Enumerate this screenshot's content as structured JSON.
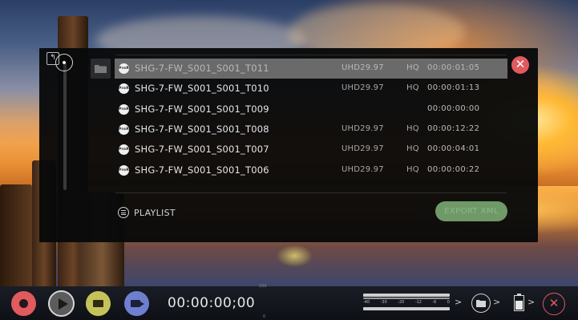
{
  "dialog": {
    "files": [
      {
        "name": "SHG-7-FW_S001_S001_T011",
        "codec": "ProRes",
        "format": "UHD29.97",
        "quality": "HQ",
        "duration": "00:00:01:05",
        "selected": true
      },
      {
        "name": "SHG-7-FW_S001_S001_T010",
        "codec": "ProRes",
        "format": "UHD29.97",
        "quality": "HQ",
        "duration": "00:00:01:13",
        "selected": false
      },
      {
        "name": "SHG-7-FW_S001_S001_T009",
        "codec": "ProRes",
        "format": "",
        "quality": "",
        "duration": "00:00:00:00",
        "selected": false
      },
      {
        "name": "SHG-7-FW_S001_S001_T008",
        "codec": "ProRes",
        "format": "UHD29.97",
        "quality": "HQ",
        "duration": "00:00:12:22",
        "selected": false
      },
      {
        "name": "SHG-7-FW_S001_S001_T007",
        "codec": "ProRes",
        "format": "UHD29.97",
        "quality": "HQ",
        "duration": "00:00:04:01",
        "selected": false
      },
      {
        "name": "SHG-7-FW_S001_S001_T006",
        "codec": "ProRes",
        "format": "UHD29.97",
        "quality": "HQ",
        "duration": "00:00:00:22",
        "selected": false
      }
    ],
    "playlist_label": "PLAYLIST",
    "export_label": "EXPORT XML",
    "close_glyph": "✕",
    "back_glyph": "↰"
  },
  "bottom_bar": {
    "timecode": "00:00:00;00",
    "meter_scale": [
      "-40",
      "-30",
      "-20",
      "-12",
      "-6",
      "0"
    ],
    "arrow_glyph": ">",
    "exit_glyph": "✕"
  },
  "icons": {
    "record": "record-icon",
    "play": "play-icon",
    "monitor": "monitor-icon",
    "camera": "camera-icon",
    "folder": "folder-icon",
    "battery": "battery-icon",
    "playlist": "playlist-icon",
    "codec": "prores-icon"
  },
  "colors": {
    "record": "#e05a5e",
    "monitor": "#c6c25a",
    "camera": "#6f7fd0",
    "export": "#6f9a68",
    "selection": "#6a6a6a"
  }
}
